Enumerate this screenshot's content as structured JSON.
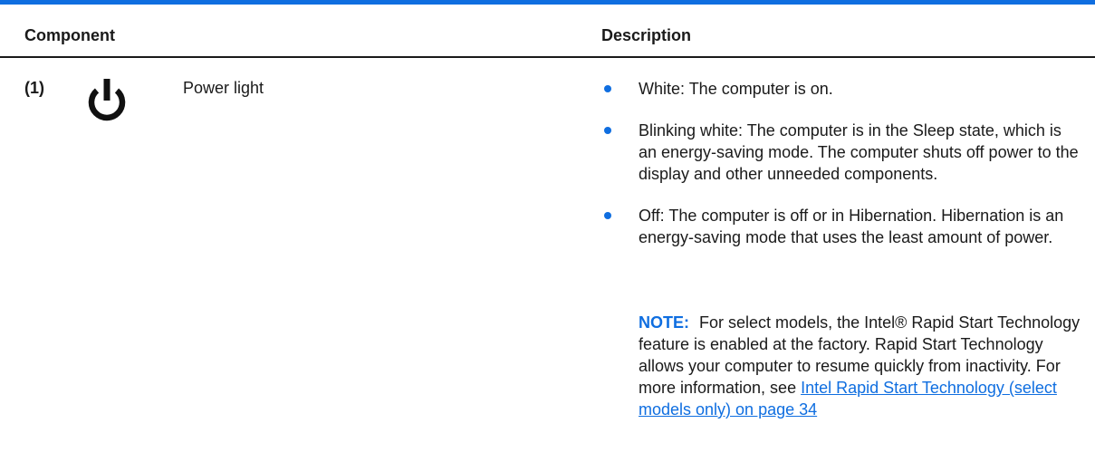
{
  "header": {
    "component_label": "Component",
    "description_label": "Description"
  },
  "row": {
    "number": "(1)",
    "icon": "power-icon",
    "name": "Power light",
    "bullets": [
      "White: The computer is on.",
      "Blinking white: The computer is in the Sleep state, which is an energy-saving mode. The computer shuts off power to the display and other unneeded components.",
      "Off: The computer is off or in Hibernation. Hibernation is an energy-saving mode that uses the least amount of power."
    ],
    "note": {
      "label": "NOTE:",
      "text": "For select models, the Intel® Rapid Start Technology feature is enabled at the factory. Rapid Start Technology allows your computer to resume quickly from inactivity. For more information, see ",
      "link_text": "Intel Rapid Start Technology (select models only) on page 34"
    }
  },
  "colors": {
    "accent": "#0f6ee0",
    "text": "#1a1a1a"
  }
}
